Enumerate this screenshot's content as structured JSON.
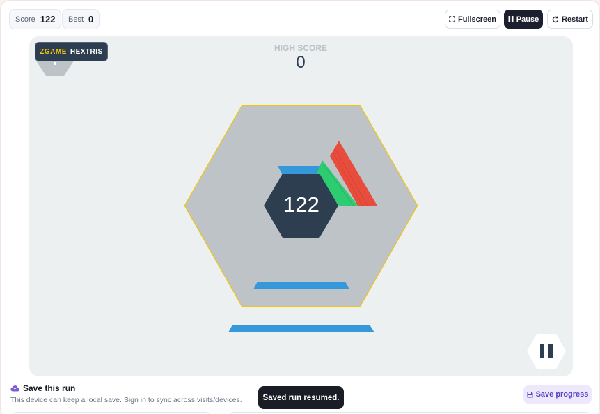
{
  "header": {
    "score_label": "Score",
    "score_value": "122",
    "best_label": "Best",
    "best_value": "0",
    "fullscreen_label": "Fullscreen",
    "pause_label": "Pause",
    "restart_label": "Restart"
  },
  "game": {
    "brand_prefix": "ZGAME",
    "brand_name": "HEXTRIS",
    "high_score_label": "HIGH SCORE",
    "high_score_value": "0",
    "current_score": "122",
    "colors": {
      "background": "#ecf0f1",
      "outer_hex": "#bdc3c7",
      "outer_outline": "#f1c40f",
      "center_hex": "#2c3e50",
      "blue": "#3498db",
      "green": "#2ecc71",
      "red": "#e74c3c"
    }
  },
  "footer": {
    "save_title": "Save this run",
    "save_desc": "This device can keep a local save. Sign in to sync across visits/devices.",
    "toast": "Saved run resumed.",
    "save_progress_label": "Save progress"
  },
  "icons": [
    "fullscreen-icon",
    "pause-icon",
    "restart-icon",
    "cloud-upload-icon",
    "floppy-disk-icon"
  ]
}
